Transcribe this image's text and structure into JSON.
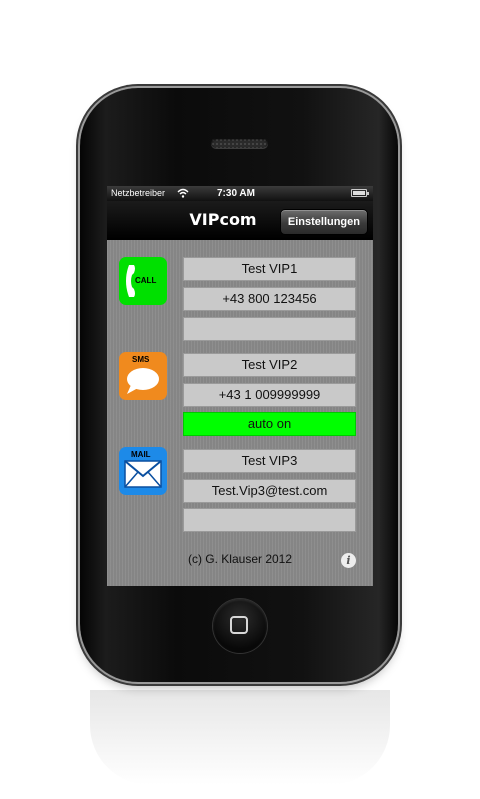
{
  "status_bar": {
    "carrier": "Netzbetreiber",
    "time": "7:30 AM",
    "icons": [
      "wifi-icon",
      "battery-icon"
    ]
  },
  "nav": {
    "title": "VIPcom",
    "settings_label": "Einstellungen"
  },
  "vips": [
    {
      "icon": "call-icon",
      "icon_label": "CALL",
      "icon_color": "#00e000",
      "name": "Test VIP1",
      "contact": "+43 800 123456",
      "status": ""
    },
    {
      "icon": "sms-icon",
      "icon_label": "SMS",
      "icon_color": "#f08a1e",
      "name": "Test VIP2",
      "contact": "+43 1 009999999",
      "status": "auto on"
    },
    {
      "icon": "mail-icon",
      "icon_label": "MAIL",
      "icon_color": "#1d8ae8",
      "name": "Test VIP3",
      "contact": "Test.Vip3@test.com",
      "status": ""
    }
  ],
  "footer": {
    "copyright": "(c) G. Klauser 2012",
    "info_glyph": "i"
  },
  "colors": {
    "auto_on": "#00ff00",
    "field_bg": "#c9c9c9"
  }
}
